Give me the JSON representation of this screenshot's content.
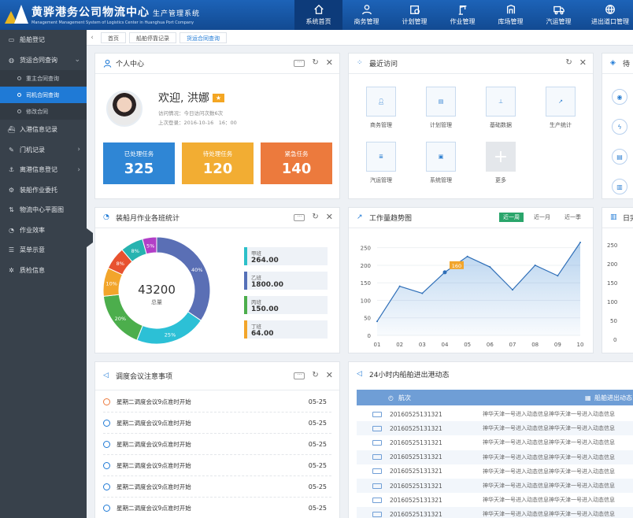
{
  "app": {
    "title": "黄骅港务公司物流中心",
    "title_suffix": "生产管理系统",
    "subtitle": "Management Management System of Logistics Center in Huanghua Port Company"
  },
  "topnav": [
    {
      "label": "系统首页",
      "icon": "home-icon",
      "active": true
    },
    {
      "label": "商务管理",
      "icon": "user-icon"
    },
    {
      "label": "计划管理",
      "icon": "calendar-icon"
    },
    {
      "label": "作业管理",
      "icon": "crane-icon"
    },
    {
      "label": "库场管理",
      "icon": "warehouse-icon"
    },
    {
      "label": "汽运管理",
      "icon": "truck-icon"
    },
    {
      "label": "进出道口管理",
      "icon": "gate-icon"
    }
  ],
  "sidebar": {
    "items": [
      {
        "label": "船舶登记",
        "icon": "monitor-icon"
      },
      {
        "label": "货运合同查询",
        "icon": "search-icon",
        "expanded": true
      },
      {
        "label": "入港信息记录",
        "icon": "ship-icon"
      },
      {
        "label": "门机记录",
        "icon": "pen-icon"
      },
      {
        "label": "离港信息登记",
        "icon": "anchor-icon"
      },
      {
        "label": "装船作业委托",
        "icon": "gear-icon"
      },
      {
        "label": "物流中心平面图",
        "icon": "arrows-icon"
      },
      {
        "label": "作业效率",
        "icon": "gauge-icon"
      },
      {
        "label": "菜单示意",
        "icon": "list-icon"
      },
      {
        "label": "质检信息",
        "icon": "gear-icon"
      }
    ],
    "subitems": [
      {
        "label": "重主合同查询"
      },
      {
        "label": "司机合同查询",
        "active": true
      },
      {
        "label": "修改合同"
      }
    ]
  },
  "tabs": [
    "首页",
    "船舶停靠记录",
    "货运合同查询"
  ],
  "profile": {
    "title": "个人中心",
    "welcome": "欢迎, 洪娜",
    "star": "★",
    "visit": "访问情况：今日访问次数6次",
    "last_login": "上次登录：2016-10-16　16：00"
  },
  "stats": [
    {
      "label": "已处理任务",
      "value": "325",
      "color": "#2f86d5"
    },
    {
      "label": "待处理任务",
      "value": "120",
      "color": "#f2ad33"
    },
    {
      "label": "紧急任务",
      "value": "140",
      "color": "#ec7a3d"
    }
  ],
  "recent": {
    "title": "最近访问",
    "items": [
      {
        "label": "商务管理",
        "icon": "user-icon"
      },
      {
        "label": "计划管理",
        "icon": "document-icon"
      },
      {
        "label": "基础数据",
        "icon": "org-chart-icon"
      },
      {
        "label": "生产统计",
        "icon": "line-chart-icon"
      },
      {
        "label": "汽运管理",
        "icon": "clipboard-icon"
      },
      {
        "label": "系统管理",
        "icon": "settings-doc-icon"
      },
      {
        "label": "更多",
        "icon": "plus-icon"
      }
    ]
  },
  "pie_panel": {
    "title": "装船月作业各班统计",
    "total_value": "43200",
    "total_label": "总量",
    "legend": [
      {
        "label": "甲班",
        "value": "264.00",
        "color": "#2cc0c9"
      },
      {
        "label": "乙班",
        "value": "1800.00",
        "color": "#5570b8"
      },
      {
        "label": "丙班",
        "value": "150.00",
        "color": "#4cae4c"
      },
      {
        "label": "丁班",
        "value": "64.00",
        "color": "#f2a52b"
      }
    ]
  },
  "trend_panel": {
    "title": "工作量趋势图",
    "tabs": [
      "近一周",
      "近一月",
      "近一季"
    ],
    "active_tab": "近一周",
    "peak_label": "160"
  },
  "meeting": {
    "title": "调度会议注意事项",
    "rows": [
      {
        "text": "星期二调度会议9点准时开始",
        "date": "05-25"
      },
      {
        "text": "星期二调度会议9点准时开始",
        "date": "05-25"
      },
      {
        "text": "星期二调度会议9点准时开始",
        "date": "05-25"
      },
      {
        "text": "星期二调度会议9点准时开始",
        "date": "05-25"
      },
      {
        "text": "星期二调度会议9点准时开始",
        "date": "05-25"
      },
      {
        "text": "星期二调度会议9点准时开始",
        "date": "05-25"
      },
      {
        "text": "星期二调度会议9点准时开始",
        "date": "05-25"
      }
    ]
  },
  "ships": {
    "title": "24小时内船舶进出港动态",
    "col_id": "航次",
    "col_status": "船舶进出动态",
    "rows": [
      {
        "id": "20160525131321",
        "status": "神华天津一号进入动态信息神华天津一号进入动态信息"
      },
      {
        "id": "20160525131321",
        "status": "神华天津一号进入动态信息神华天津一号进入动态信息"
      },
      {
        "id": "20160525131321",
        "status": "神华天津一号进入动态信息神华天津一号进入动态信息"
      },
      {
        "id": "20160525131321",
        "status": "神华天津一号进入动态信息神华天津一号进入动态信息"
      },
      {
        "id": "20160525131321",
        "status": "神华天津一号进入动态信息神华天津一号进入动态信息"
      },
      {
        "id": "20160525131321",
        "status": "神华天津一号进入动态信息神华天津一号进入动态信息"
      },
      {
        "id": "20160525131321",
        "status": "神华天津一号进入动态信息神华天津一号进入动态信息"
      },
      {
        "id": "20160525131321",
        "status": "神华天津一号进入动态信息神华天津一号进入动态信息"
      }
    ]
  },
  "right_cut": {
    "title1": "待",
    "title2": "日完"
  },
  "chart_data": [
    {
      "type": "pie",
      "title": "装船月作业各班统计",
      "slices": [
        {
          "label": "40%",
          "value": 40,
          "color": "#5a6fb5"
        },
        {
          "label": "25%",
          "value": 25,
          "color": "#2cc0d6"
        },
        {
          "label": "20%",
          "value": 20,
          "color": "#4cae4c"
        },
        {
          "label": "10%",
          "value": 10,
          "color": "#f2a52b"
        },
        {
          "label": "8%",
          "value": 8,
          "color": "#e8522f"
        },
        {
          "label": "8%",
          "value": 8,
          "color": "#27b3b0"
        },
        {
          "label": "5%",
          "value": 5,
          "color": "#b23fc7"
        }
      ],
      "center_value": "43200",
      "center_label": "总量"
    },
    {
      "type": "area",
      "title": "工作量趋势图",
      "x": [
        "01",
        "02",
        "03",
        "04",
        "05",
        "06",
        "07",
        "08",
        "09",
        "10"
      ],
      "y": [
        40,
        140,
        120,
        180,
        225,
        195,
        130,
        200,
        170,
        265
      ],
      "ylim": [
        0,
        250
      ],
      "yticks": [
        0,
        50,
        100,
        150,
        200,
        250
      ],
      "annotation": "160"
    }
  ]
}
